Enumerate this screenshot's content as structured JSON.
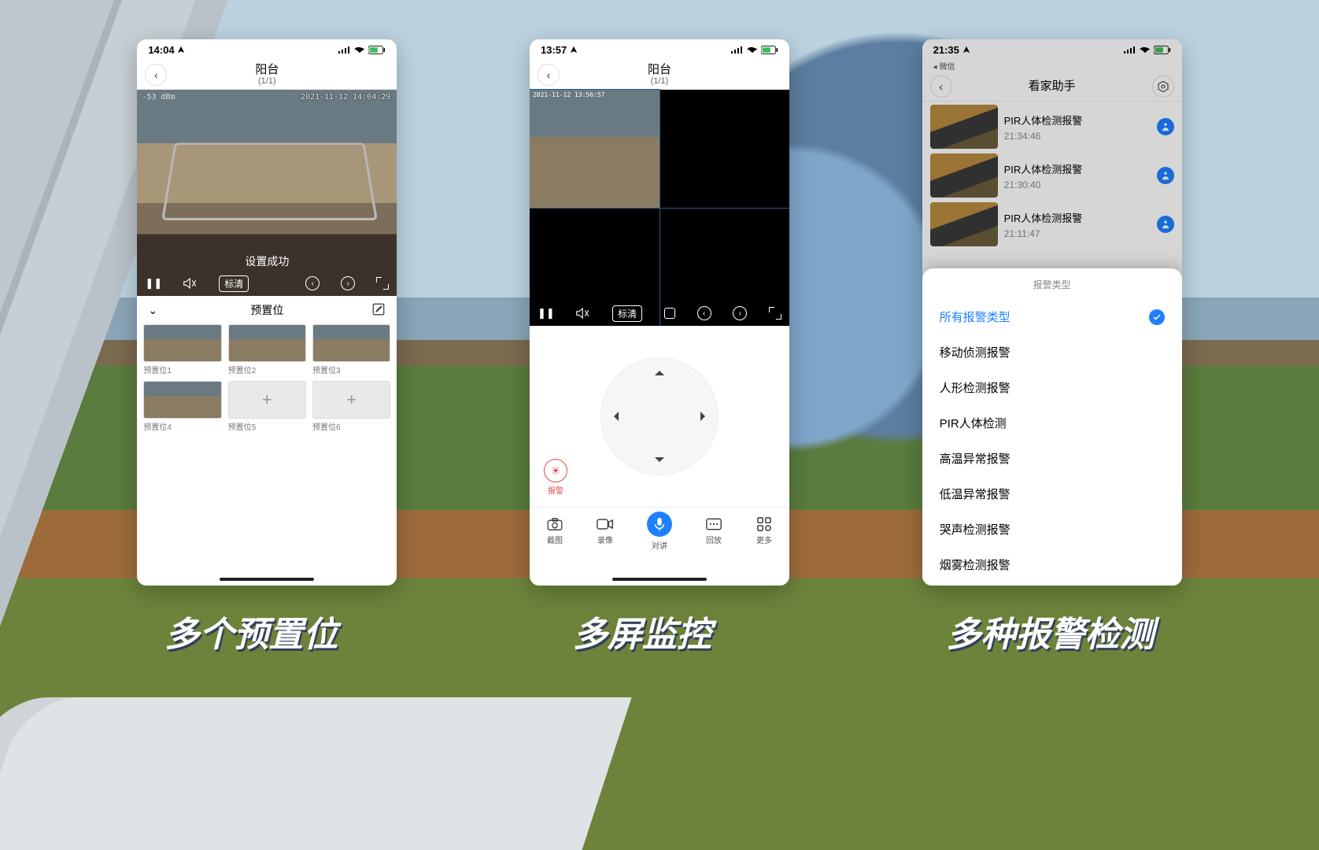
{
  "captions": [
    "多个预置位",
    "多屏监控",
    "多种报警检测"
  ],
  "phone1": {
    "time": "14:04",
    "header_title": "阳台",
    "header_sub": "(1/1)",
    "signal": "-53 dBm",
    "timestamp": "2021-11-12 14:04:29",
    "toast": "设置成功",
    "quality": "标清",
    "preset_title": "预置位",
    "presets": [
      {
        "label": "预置位1",
        "empty": false
      },
      {
        "label": "预置位2",
        "empty": false
      },
      {
        "label": "预置位3",
        "empty": false
      },
      {
        "label": "预置位4",
        "empty": false
      },
      {
        "label": "预置位5",
        "empty": true
      },
      {
        "label": "预置位6",
        "empty": true
      }
    ]
  },
  "phone2": {
    "time": "13:57",
    "header_title": "阳台",
    "header_sub": "(1/1)",
    "quality": "标清",
    "cell_timestamp": "2021-11-12 13:56:57",
    "alarm_label": "报警",
    "tabs": [
      {
        "label": "截图"
      },
      {
        "label": "录像"
      },
      {
        "label": "对讲"
      },
      {
        "label": "回放"
      },
      {
        "label": "更多"
      }
    ]
  },
  "phone3": {
    "time": "21:35",
    "return_app": "微信",
    "header_title": "看家助手",
    "events": [
      {
        "title": "PIR人体检测报警",
        "time": "21:34:46"
      },
      {
        "title": "PIR人体检测报警",
        "time": "21:30:40"
      },
      {
        "title": "PIR人体检测报警",
        "time": "21:11:47"
      }
    ],
    "sheet_title": "报警类型",
    "options": [
      {
        "label": "所有报警类型",
        "selected": true
      },
      {
        "label": "移动侦测报警",
        "selected": false
      },
      {
        "label": "人形检测报警",
        "selected": false
      },
      {
        "label": "PIR人体检测",
        "selected": false
      },
      {
        "label": "高温异常报警",
        "selected": false
      },
      {
        "label": "低温异常报警",
        "selected": false
      },
      {
        "label": "哭声检测报警",
        "selected": false
      },
      {
        "label": "烟雾检测报警",
        "selected": false
      }
    ]
  }
}
